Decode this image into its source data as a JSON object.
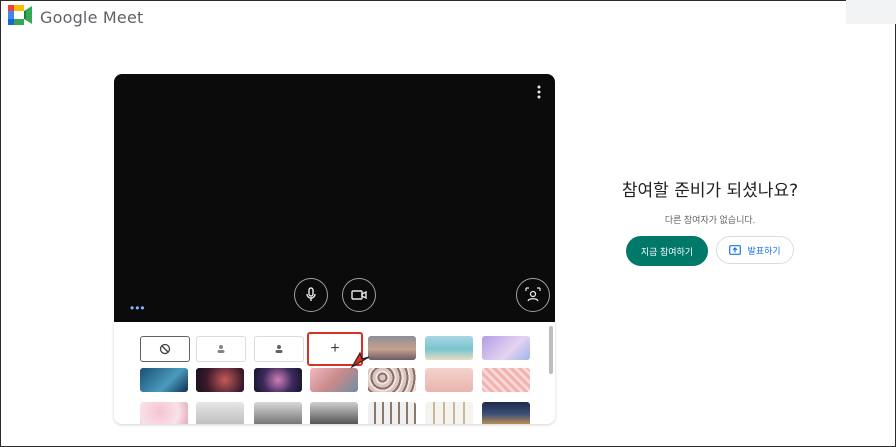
{
  "app": {
    "brand": "Google Meet",
    "icon": "meet-logo-icon"
  },
  "preview": {
    "controls": [
      {
        "name": "mic-button",
        "icon": "microphone-icon"
      },
      {
        "name": "camera-button",
        "icon": "video-camera-icon"
      },
      {
        "name": "effects-button",
        "icon": "visual-effects-icon"
      }
    ],
    "more_icon": "more-vert-icon"
  },
  "backgrounds": {
    "row1": [
      "none",
      "slight-blur",
      "blur",
      "upload",
      "sunset-sea",
      "beach",
      "purple-sky"
    ],
    "row2": [
      "ocean",
      "nebula-red",
      "galaxy",
      "cherry-blossom",
      "pebbles",
      "pink-wall",
      "pink-pattern"
    ],
    "row3": [
      "pink-flowers",
      "office",
      "loft",
      "gallery",
      "library",
      "shelves",
      "night-hotel"
    ]
  },
  "join": {
    "title": "참여할 준비가 되셨나요?",
    "subtitle": "다른 참여자가 없습니다.",
    "join_label": "지금 참여하기",
    "present_label": "발표하기"
  },
  "colors": {
    "primary": "#00796b",
    "accent": "#1a73e8"
  }
}
